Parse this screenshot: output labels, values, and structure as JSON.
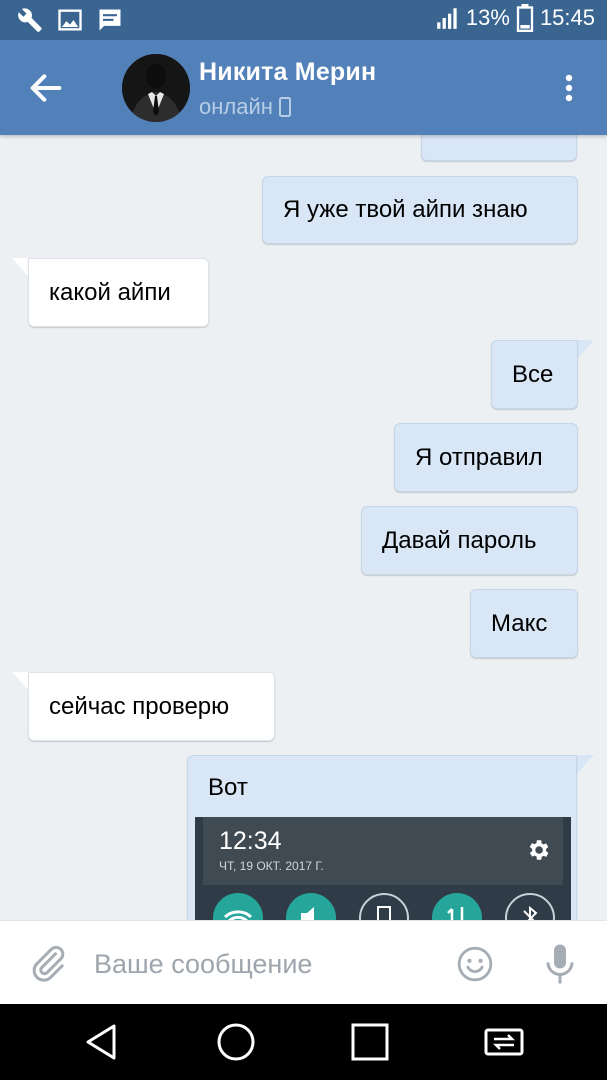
{
  "status_bar": {
    "battery_percent": "13%",
    "time": "15:45",
    "icons": [
      "wrench-icon",
      "image-icon",
      "message-icon",
      "signal-icon",
      "battery-icon"
    ]
  },
  "header": {
    "contact_name": "Никита Мерин",
    "status": "онлайн",
    "icons": [
      "back-arrow-icon",
      "mobile-icon",
      "more-vert-icon"
    ]
  },
  "messages": [
    {
      "direction": "out",
      "text": ""
    },
    {
      "direction": "out",
      "text": "Я уже твой айпи знаю"
    },
    {
      "direction": "in",
      "text": "какой айпи"
    },
    {
      "direction": "out",
      "text": "Все"
    },
    {
      "direction": "out",
      "text": "Я отправил"
    },
    {
      "direction": "out",
      "text": "Давай пароль"
    },
    {
      "direction": "out",
      "text": "Макс"
    },
    {
      "direction": "in",
      "text": "сейчас проверю"
    },
    {
      "direction": "out",
      "text": "Вот",
      "attachment": "screenshot"
    }
  ],
  "attachment_screenshot": {
    "time": "12:34",
    "date": "ЧТ, 19 ОКТ. 2017 Г.",
    "quick_settings_icons": [
      "wifi-icon",
      "volume-icon",
      "rotate-icon",
      "data-icon",
      "bluetooth-icon"
    ],
    "accent": "#26a69a"
  },
  "input": {
    "placeholder": "Ваше сообщение",
    "value": "",
    "icons": [
      "paperclip-icon",
      "emoji-icon",
      "mic-icon"
    ]
  },
  "nav_bar": {
    "icons": [
      "back-icon",
      "home-icon",
      "recents-icon",
      "switch-sim-icon"
    ]
  },
  "colors": {
    "header": "#5181b8",
    "status_bar": "#3a6591",
    "outgoing_bubble": "#d8e6f5",
    "incoming_bubble": "#ffffff",
    "background": "#edf0f3"
  }
}
